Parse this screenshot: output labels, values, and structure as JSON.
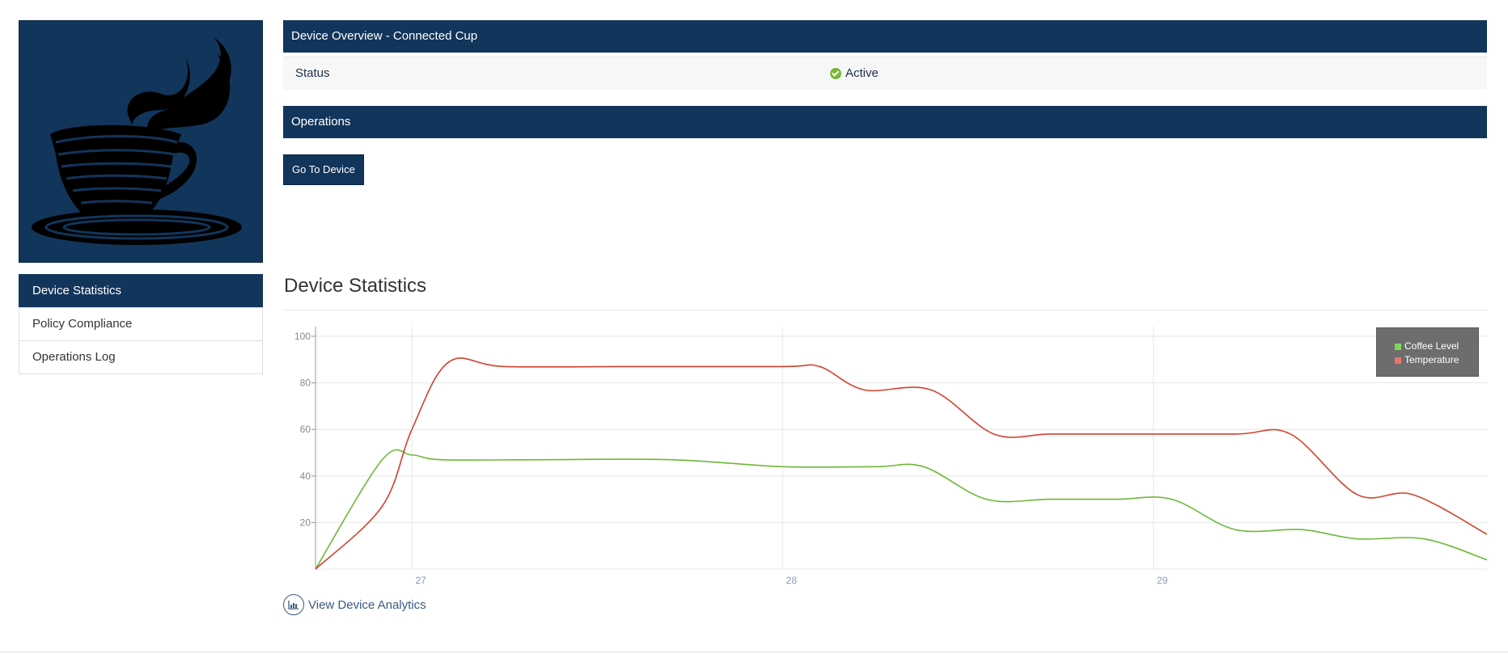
{
  "overview": {
    "title": "Device Overview - Connected Cup",
    "status_label": "Status",
    "status_value": "Active",
    "status_color": "#7ab83a"
  },
  "operations": {
    "title": "Operations",
    "go_button": "Go To Device"
  },
  "side_nav": {
    "items": [
      {
        "label": "Device Statistics"
      },
      {
        "label": "Policy Compliance"
      },
      {
        "label": "Operations Log"
      }
    ]
  },
  "device_image": {
    "icon": "coffee-cup-icon"
  },
  "stats": {
    "title": "Device Statistics"
  },
  "analytics_link": {
    "label": "View Device Analytics",
    "icon": "analytics-chart-icon"
  },
  "colors": {
    "brand": "#12355b",
    "coffee": "#6cb836",
    "temperature": "#d2412e"
  },
  "chart_data": {
    "type": "line",
    "title": "",
    "xlabel": "",
    "ylabel": "",
    "x_ticks": [
      "27",
      "28",
      "29"
    ],
    "y_ticks": [
      20,
      40,
      60,
      80,
      100
    ],
    "ylim": [
      0,
      100
    ],
    "xlim": [
      26.74,
      29.9
    ],
    "grid": true,
    "legend_position": "top-right",
    "series": [
      {
        "name": "Coffee Level",
        "color": "#6cb836",
        "points": [
          [
            26.74,
            0
          ],
          [
            26.92,
            47
          ],
          [
            27.0,
            49
          ],
          [
            27.08,
            47
          ],
          [
            27.35,
            47
          ],
          [
            27.7,
            47
          ],
          [
            28.0,
            44
          ],
          [
            28.25,
            44
          ],
          [
            28.38,
            44
          ],
          [
            28.55,
            30
          ],
          [
            28.72,
            30
          ],
          [
            28.9,
            30
          ],
          [
            29.05,
            30
          ],
          [
            29.22,
            17
          ],
          [
            29.4,
            17
          ],
          [
            29.55,
            13
          ],
          [
            29.73,
            13
          ],
          [
            29.9,
            4
          ]
        ]
      },
      {
        "name": "Temperature",
        "color": "#d2412e",
        "points": [
          [
            26.74,
            0
          ],
          [
            26.92,
            27
          ],
          [
            27.0,
            60
          ],
          [
            27.1,
            89
          ],
          [
            27.25,
            87
          ],
          [
            27.6,
            87
          ],
          [
            28.0,
            87
          ],
          [
            28.1,
            87
          ],
          [
            28.22,
            77
          ],
          [
            28.4,
            77
          ],
          [
            28.57,
            58
          ],
          [
            28.72,
            58
          ],
          [
            28.9,
            58
          ],
          [
            29.22,
            58
          ],
          [
            29.37,
            58
          ],
          [
            29.55,
            32
          ],
          [
            29.7,
            32
          ],
          [
            29.9,
            15
          ]
        ]
      }
    ]
  }
}
